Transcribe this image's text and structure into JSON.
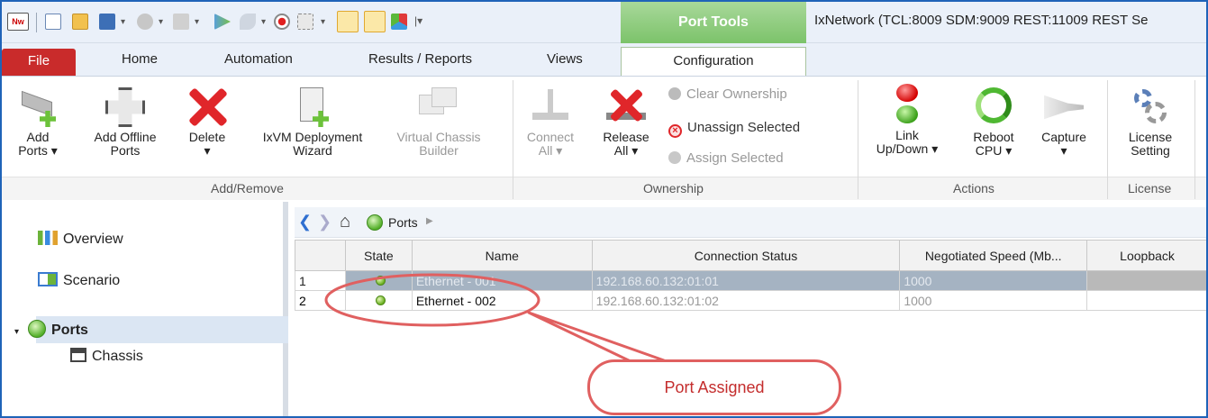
{
  "window": {
    "app_icon": "Nw",
    "context_tab": "Port Tools",
    "title": "IxNetwork (TCL:8009 SDM:9009 REST:11009 REST Se"
  },
  "ribbon_tabs": {
    "file": "File",
    "home": "Home",
    "automation": "Automation",
    "results": "Results / Reports",
    "views": "Views",
    "configuration": "Configuration"
  },
  "groups": {
    "add_remove": "Add/Remove",
    "ownership": "Ownership",
    "actions": "Actions",
    "license": "License"
  },
  "buttons": {
    "add_ports": [
      "Add",
      "Ports ▾"
    ],
    "add_offline": [
      "Add Offline",
      "Ports"
    ],
    "delete": [
      "Delete",
      "▾"
    ],
    "ixvm": [
      "IxVM Deployment",
      "Wizard"
    ],
    "virtual_chassis": [
      "Virtual Chassis",
      "Builder"
    ],
    "connect_all": [
      "Connect",
      "All ▾"
    ],
    "release_all": [
      "Release",
      "All ▾"
    ],
    "clear_ownership": "Clear Ownership",
    "unassign_selected": "Unassign Selected",
    "assign_selected": "Assign Selected",
    "link_updown": [
      "Link",
      "Up/Down ▾"
    ],
    "reboot_cpu": [
      "Reboot",
      "CPU ▾"
    ],
    "capture": [
      "Capture",
      "▾"
    ],
    "license_setting": [
      "License",
      "Setting"
    ]
  },
  "nav": {
    "overview": "Overview",
    "scenario": "Scenario",
    "ports": "Ports",
    "chassis": "Chassis"
  },
  "breadcrumb": {
    "current": "Ports"
  },
  "grid": {
    "columns": [
      "State",
      "Name",
      "Connection Status",
      "Negotiated Speed (Mb...",
      "Loopback"
    ],
    "rows": [
      {
        "index": "1",
        "name": "Ethernet - 001",
        "connection": "192.168.60.132:01:01",
        "speed": "1000"
      },
      {
        "index": "2",
        "name": "Ethernet - 002",
        "connection": "192.168.60.132:01:02",
        "speed": "1000"
      }
    ]
  },
  "annotation": "Port Assigned",
  "colors": {
    "file_tab": "#c92b2b",
    "context_tab": "#7cc36a",
    "annotation": "#e06060",
    "selected_row": "#a5b3c2"
  }
}
